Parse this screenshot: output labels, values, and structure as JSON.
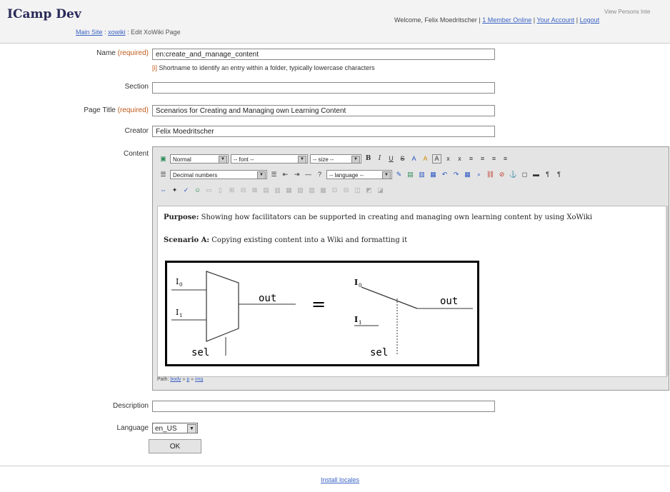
{
  "header": {
    "brand": "ICamp Dev",
    "crumbs": {
      "main_site": "Main Site",
      "xowiki": "xowiki",
      "sep": ":",
      "current": "Edit XoWiki Page"
    },
    "welcome": "Welcome, Felix Moedritscher |",
    "members_online": "1 Member Online",
    "account": "Your Account",
    "logout": "Logout",
    "view_persons": "View Persons Inte",
    "sep": "|"
  },
  "form": {
    "name": {
      "label": "Name",
      "required": "(required)",
      "value": "en:create_and_manage_content"
    },
    "hint": {
      "marker": "[i]",
      "text": "Shortname to identify an entry within a folder, typically lowercase characters"
    },
    "section": {
      "label": "Section",
      "value": ""
    },
    "page_title": {
      "label": "Page Title",
      "required": "(required)",
      "value": "Scenarios for Creating and Managing own Learning Content"
    },
    "creator": {
      "label": "Creator",
      "value": "Felix Moedritscher"
    },
    "content": {
      "label": "Content"
    },
    "description": {
      "label": "Description",
      "value": ""
    },
    "language": {
      "label": "Language",
      "value": "en_US"
    },
    "ok": "OK"
  },
  "editor": {
    "format_select": "Normal",
    "font_select": "-- font --",
    "size_select": "-- size --",
    "list_select": "Decimal numbers",
    "language_select": "-- language --",
    "purpose_label": "Purpose:",
    "purpose_text": "Showing how facilitators can be supported in creating and managing own learning content by using XoWiki",
    "scenario_label": "Scenario A:",
    "scenario_text": "Copying existing content into a Wiki and formatting it",
    "path_label": "Path:",
    "path_body": "body",
    "path_p": "p",
    "path_img": "img",
    "path_sep": "»",
    "diagram": {
      "i0": "I",
      "i0_sub": "0",
      "i1": "I",
      "i1_sub": "1",
      "out": "out",
      "sel": "sel",
      "equals": "="
    }
  },
  "footer": {
    "install_locales": "Install locales"
  }
}
